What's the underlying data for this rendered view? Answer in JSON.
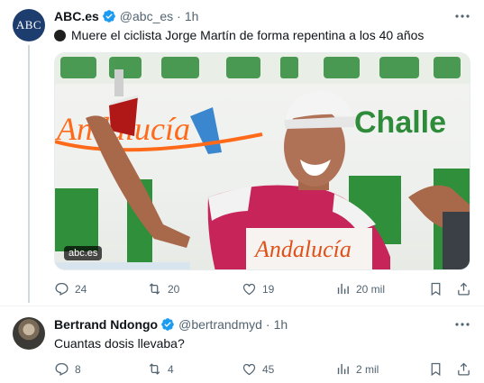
{
  "tweets": [
    {
      "author": {
        "name": "ABC.es",
        "handle": "@abc_es",
        "avatar_text": "ABC"
      },
      "time": "1h",
      "text": "Muere el ciclista Jorge Martín de forma repentina a los 40 años",
      "media": {
        "badge": "abc.es",
        "banner_left": "Andalucía",
        "banner_right": "Challe",
        "jersey_text": "Andalucía"
      },
      "stats": {
        "replies": "24",
        "retweets": "20",
        "likes": "19",
        "views": "20 mil"
      }
    },
    {
      "author": {
        "name": "Bertrand Ndongo",
        "handle": "@bertrandmyd"
      },
      "time": "1h",
      "text": "Cuantas dosis llevaba?",
      "stats": {
        "replies": "8",
        "retweets": "4",
        "likes": "45",
        "views": "2 mil"
      }
    }
  ],
  "separator": "·",
  "colors": {
    "verified": "#1d9bf0",
    "secondary_text": "#536471",
    "abc_blue": "#1c3d6e"
  }
}
